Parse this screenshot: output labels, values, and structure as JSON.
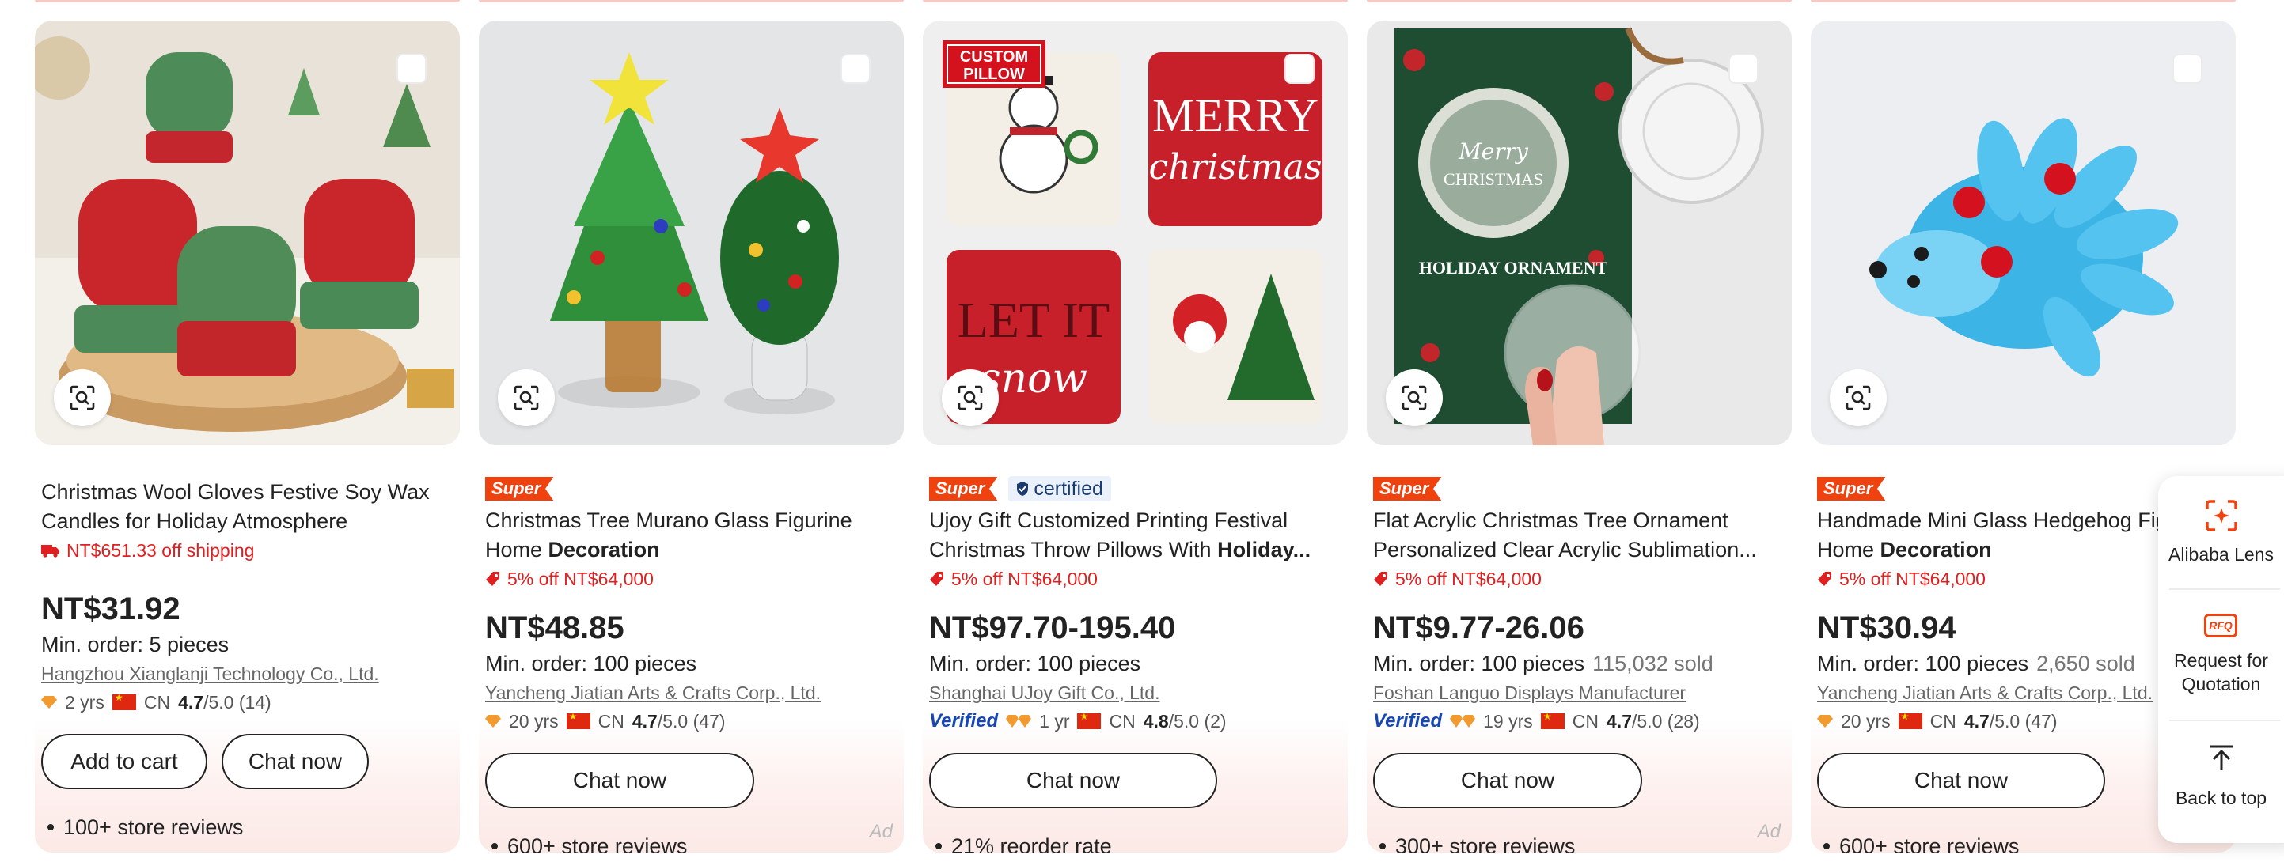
{
  "colors": {
    "accent": "#f0420f",
    "promo": "#e02020",
    "verified": "#1747b5"
  },
  "products": [
    {
      "super": false,
      "certified": false,
      "title_plain": "Christmas Wool Gloves Festive Soy Wax Candles for Holiday Atmosphere",
      "title_bold": "",
      "promo_icon": "truck-icon",
      "promo": "NT$651.33 off shipping",
      "price": "NT$31.92",
      "min_order": "Min. order: 5 pieces",
      "sold": "",
      "supplier": "Hangzhou Xianglanji Technology Co., Ltd.",
      "verified": false,
      "years": "2 yrs",
      "country": "CN",
      "rating": "4.7",
      "rating_suffix": "/5.0 (14)",
      "buttons": [
        "Add to cart",
        "Chat now"
      ],
      "reviews": "100+ store reviews",
      "ad": ""
    },
    {
      "super": true,
      "certified": false,
      "title_plain": "Christmas Tree Murano Glass Figurine Home ",
      "title_bold": "Decoration",
      "promo_icon": "tag-icon",
      "promo": "5% off NT$64,000",
      "price": "NT$48.85",
      "min_order": "Min. order: 100 pieces",
      "sold": "",
      "supplier": "Yancheng Jiatian Arts & Crafts Corp., Ltd.",
      "verified": false,
      "years": "20 yrs",
      "country": "CN",
      "rating": "4.7",
      "rating_suffix": "/5.0 (47)",
      "buttons": [
        "Chat now"
      ],
      "reviews": "600+ store reviews",
      "ad": "Ad"
    },
    {
      "super": true,
      "certified": true,
      "title_plain": "Ujoy Gift Customized Printing Festival Christmas Throw Pillows With ",
      "title_bold": "Holiday...",
      "promo_icon": "tag-icon",
      "promo": "5% off NT$64,000",
      "price": "NT$97.70-195.40",
      "min_order": "Min. order: 100 pieces",
      "sold": "",
      "supplier": "Shanghai UJoy Gift Co., Ltd.",
      "verified": true,
      "years": "1 yr",
      "country": "CN",
      "rating": "4.8",
      "rating_suffix": "/5.0 (2)",
      "buttons": [
        "Chat now"
      ],
      "reviews": "21% reorder rate",
      "ad": ""
    },
    {
      "super": true,
      "certified": false,
      "title_plain": "Flat Acrylic Christmas Tree Ornament Personalized Clear Acrylic Sublimation...",
      "title_bold": "",
      "promo_icon": "tag-icon",
      "promo": "5% off NT$64,000",
      "price": "NT$9.77-26.06",
      "min_order": "Min. order: 100 pieces",
      "sold": "115,032 sold",
      "supplier": "Foshan Languo Displays Manufacturer",
      "verified": true,
      "years": "19 yrs",
      "country": "CN",
      "rating": "4.7",
      "rating_suffix": "/5.0 (28)",
      "buttons": [
        "Chat now"
      ],
      "reviews": "300+ store reviews",
      "ad": "Ad"
    },
    {
      "super": true,
      "certified": false,
      "title_plain": "Handmade Mini Glass Hedgehog Figurine Home ",
      "title_bold": "Decoration",
      "promo_icon": "tag-icon",
      "promo": "5% off NT$64,000",
      "price": "NT$30.94",
      "min_order": "Min. order: 100 pieces",
      "sold": "2,650 sold",
      "supplier": "Yancheng Jiatian Arts & Crafts Corp., Ltd.",
      "verified": false,
      "years": "20 yrs",
      "country": "CN",
      "rating": "4.7",
      "rating_suffix": "/5.0 (47)",
      "buttons": [
        "Chat now"
      ],
      "reviews": "600+ store reviews",
      "ad": ""
    }
  ],
  "badges": {
    "super_label": "Super",
    "certified_label": "certified",
    "verified_label": "Verified"
  },
  "image_text": {
    "pillow_tag": [
      "CUSTOM",
      "PILLOW"
    ],
    "merry": "MERRY",
    "christmas_script": "christmas",
    "let_it": "LET IT",
    "snow": "snow",
    "ornament_merry": "Merry",
    "ornament_christmas": "CHRISTMAS",
    "holiday_ornament": "HOLIDAY ORNAMENT"
  },
  "side_panel": {
    "lens_label": "Alibaba Lens",
    "rfq_badge": "RFQ",
    "rfq_label_1": "Request for",
    "rfq_label_2": "Quotation",
    "top_label": "Back to top"
  }
}
